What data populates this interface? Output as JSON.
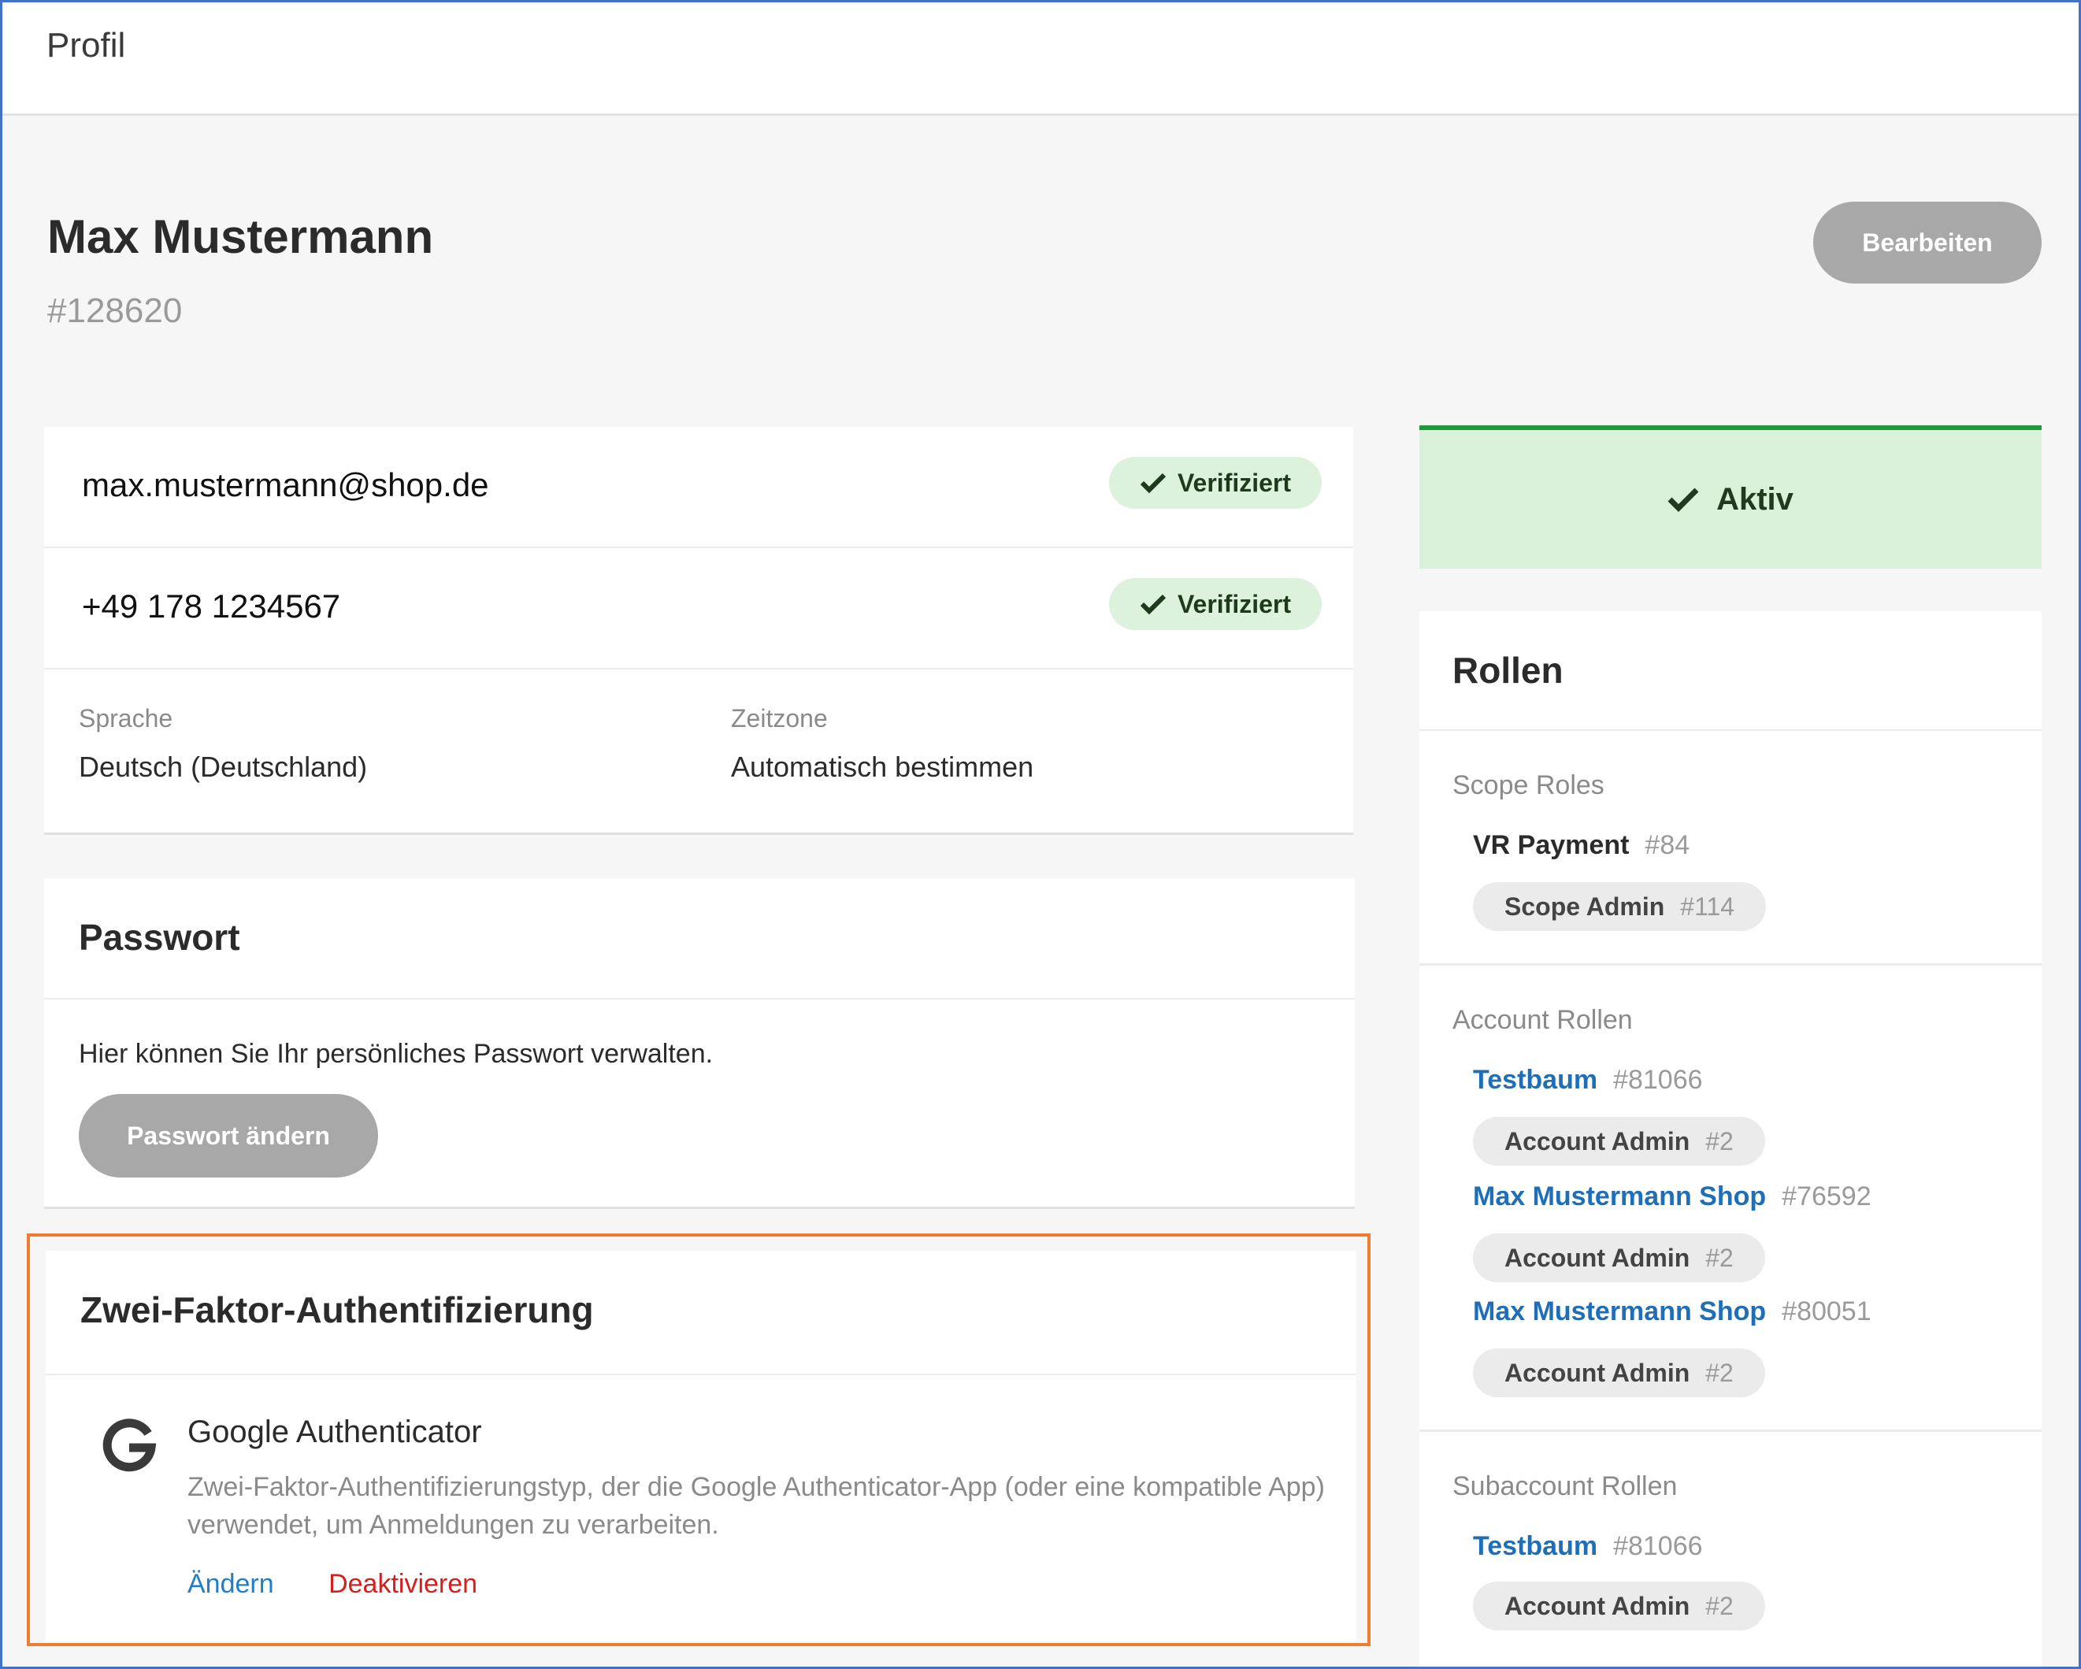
{
  "header": {
    "title": "Profil"
  },
  "user": {
    "name": "Max Mustermann",
    "id": "#128620",
    "edit_label": "Bearbeiten"
  },
  "contact": {
    "email": "max.mustermann@shop.de",
    "email_status": "Verifiziert",
    "phone": "+49 178 1234567",
    "phone_status": "Verifiziert",
    "language_label": "Sprache",
    "language_value": "Deutsch (Deutschland)",
    "timezone_label": "Zeitzone",
    "timezone_value": "Automatisch bestimmen"
  },
  "password": {
    "title": "Passwort",
    "description": "Hier können Sie Ihr persönliches Passwort verwalten.",
    "change_label": "Passwort ändern"
  },
  "two_factor": {
    "title": "Zwei-Faktor-Authentifizierung",
    "method_name": "Google Authenticator",
    "description": "Zwei-Faktor-Authentifizierungstyp, der die Google Authenticator-App (oder eine kompatible App) verwendet, um Anmeldungen zu verarbeiten.",
    "change_label": "Ändern",
    "deactivate_label": "Deaktivieren"
  },
  "status": {
    "label": "Aktiv",
    "color": "#1f9a3a"
  },
  "roles": {
    "title": "Rollen",
    "scope": {
      "label": "Scope Roles",
      "entity_name": "VR Payment",
      "entity_id": "#84",
      "role_name": "Scope Admin",
      "role_id": "#114"
    },
    "account": {
      "label": "Account Rollen",
      "entries": [
        {
          "entity_name": "Testbaum",
          "entity_id": "#81066",
          "role_name": "Account Admin",
          "role_id": "#2"
        },
        {
          "entity_name": "Max Mustermann Shop",
          "entity_id": "#76592",
          "role_name": "Account Admin",
          "role_id": "#2"
        },
        {
          "entity_name": "Max Mustermann Shop",
          "entity_id": "#80051",
          "role_name": "Account Admin",
          "role_id": "#2"
        }
      ]
    },
    "subaccount": {
      "label": "Subaccount Rollen",
      "entries": [
        {
          "entity_name": "Testbaum",
          "entity_id": "#81066",
          "role_name": "Account Admin",
          "role_id": "#2"
        }
      ]
    }
  },
  "colors": {
    "link": "#1f6fb8",
    "danger": "#d41f1f",
    "highlight": "#ed7d31",
    "badge_bg": "#dcf2dc"
  }
}
